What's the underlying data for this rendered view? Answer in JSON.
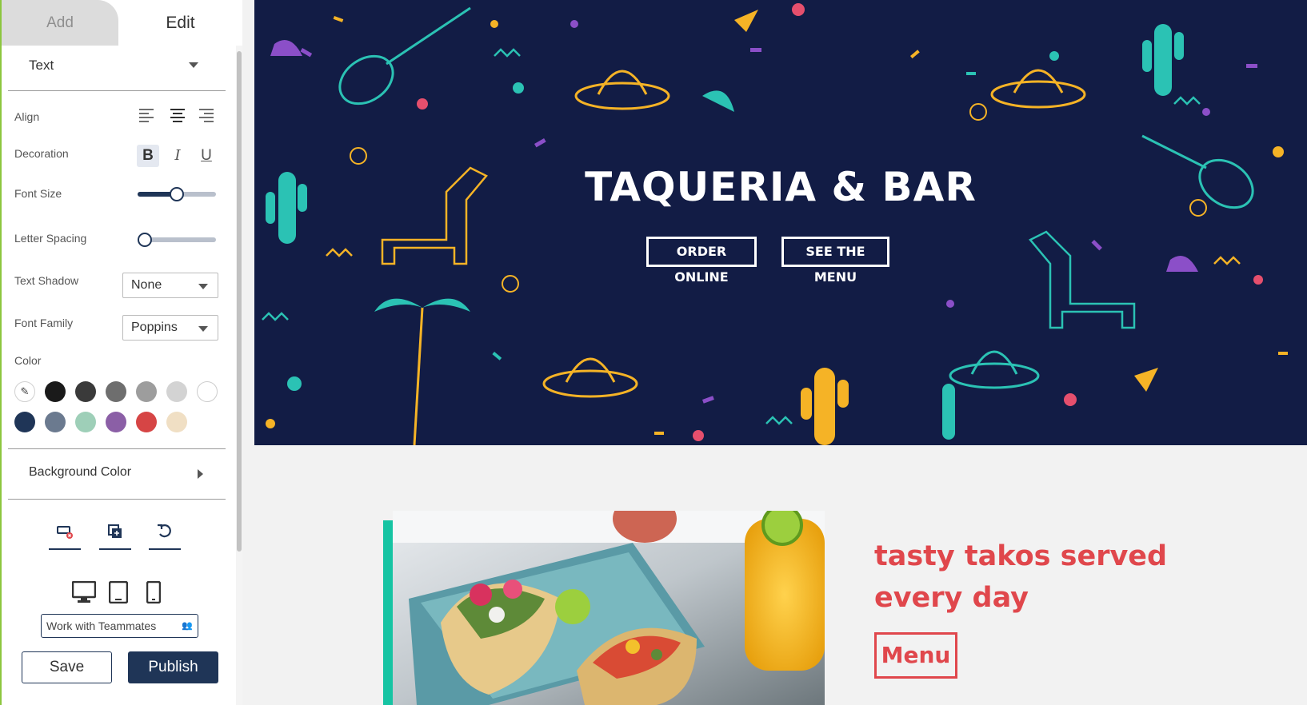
{
  "sidebar": {
    "tabs": {
      "add": "Add",
      "edit": "Edit"
    },
    "element_type": "Text",
    "labels": {
      "align": "Align",
      "decoration": "Decoration",
      "font_size": "Font Size",
      "letter_spacing": "Letter Spacing",
      "text_shadow": "Text Shadow",
      "font_family": "Font Family",
      "color": "Color",
      "background_color": "Background Color"
    },
    "align_selected": "center",
    "decoration": {
      "bold": "B",
      "italic": "I",
      "underline": "U",
      "bold_active": true
    },
    "font_size_level": 0.5,
    "letter_spacing_level": 0.0,
    "text_shadow_value": "None",
    "font_family_value": "Poppins",
    "color_swatches": [
      "#1a1a1a",
      "#3a3a3a",
      "#6e6e6e",
      "#9d9d9d",
      "#d3d3d3",
      "#ffffff",
      "#1f3557",
      "#6b7a8f",
      "#9ecfb8",
      "#8b5fa6",
      "#d64545",
      "#f0dfc4"
    ],
    "team_button": "Work with Teammates",
    "save": "Save",
    "publish": "Publish"
  },
  "canvas": {
    "hero_title": "TAQUERIA & BAR",
    "order_button": "ORDER ONLINE",
    "menu_link_button": "SEE THE MENU",
    "tagline": "tasty takos served every day",
    "menu_button": "Menu",
    "accent_color": "#e0474c",
    "hero_bg": "#121c45",
    "bar_color": "#16c4a3"
  }
}
